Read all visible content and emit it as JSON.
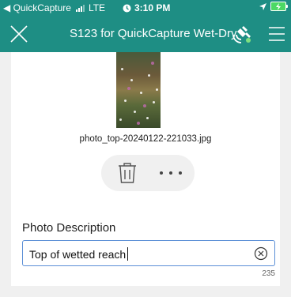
{
  "status_bar": {
    "back_app": "◀ QuickCapture",
    "network": "LTE",
    "time": "3:10 PM"
  },
  "header": {
    "title": "S123 for QuickCapture Wet-Dry",
    "accent": "#1e8e84"
  },
  "photo": {
    "filename": "photo_top-20240122-221033.jpg"
  },
  "photo_actions": {
    "delete_icon": "trash-icon",
    "more_icon": "more-dots-icon"
  },
  "description_field": {
    "label": "Photo Description",
    "value": "Top of wetted reach",
    "remaining_chars": "235"
  }
}
